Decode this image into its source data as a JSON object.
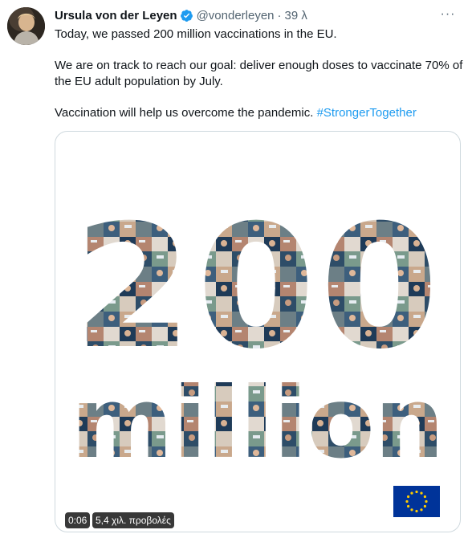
{
  "author": {
    "name": "Ursula von der Leyen",
    "handle": "@vonderleyen",
    "separator": "·",
    "time": "39 λ",
    "verified_icon": "verified-badge-icon",
    "more_icon": "more-options-icon"
  },
  "tweet": {
    "line1": "Today, we passed 200 million vaccinations in the EU.",
    "line2": "We are on track to reach our goal: deliver enough doses to vaccinate 70% of the EU adult population by July.",
    "line3": "Vaccination will help us overcome the pandemic.",
    "hashtag": "#StrongerTogether"
  },
  "video": {
    "graphic_number": "200",
    "graphic_word": "million",
    "duration": "0:06",
    "views": "5,4 χιλ. προβολές",
    "flag_icon": "eu-flag-icon"
  },
  "colors": {
    "hashtag": "#1d9bf0",
    "verified": "#1d9bf0",
    "secondary_text": "#536471",
    "border": "#cfd9de",
    "eu_blue": "#003399",
    "eu_gold": "#ffcc00"
  }
}
